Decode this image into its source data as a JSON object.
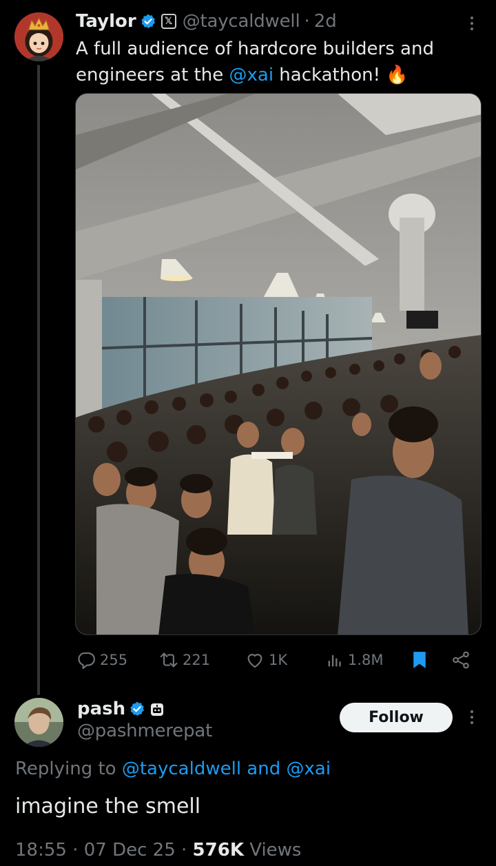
{
  "tweet": {
    "author_name": "Taylor",
    "handle": "@taycaldwell",
    "dot": "·",
    "time": "2d",
    "text_before": "A full audience of hardcore builders and engineers at the ",
    "mention": "@xai",
    "text_after": " hackathon! 🔥",
    "media_icon": "photo-of-hackathon-audience",
    "actions": {
      "replies": "255",
      "reposts": "221",
      "likes": "1K",
      "views": "1.8M"
    }
  },
  "reply": {
    "author_name": "pash",
    "handle": "@pashmerepat",
    "follow_label": "Follow",
    "replying_prefix": "Replying to ",
    "replying_to_1": "@taycaldwell",
    "replying_and": " and ",
    "replying_to_2": "@xai",
    "text": "imagine the smell",
    "time": "18:55",
    "dot1": "·",
    "date": "07 Dec 25",
    "dot2": "·",
    "views_count": "576K",
    "views_label": "Views"
  },
  "colors": {
    "background": "#000000",
    "text": "#e7e9ea",
    "muted": "#71767b",
    "accent": "#1d9bf0",
    "verified_gold": "#1d9bf0"
  },
  "icons": [
    "verified-badge-icon",
    "x-affiliation-icon",
    "more-icon",
    "reply-icon",
    "repost-icon",
    "like-icon",
    "views-icon",
    "bookmark-icon",
    "share-icon",
    "bot-badge-icon"
  ]
}
